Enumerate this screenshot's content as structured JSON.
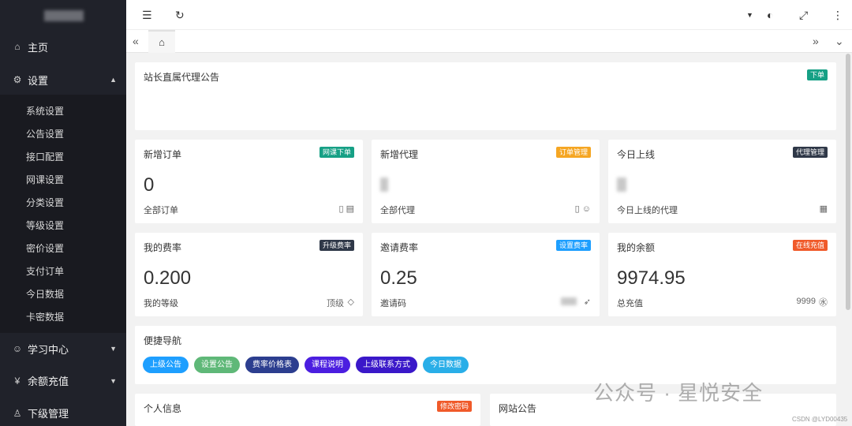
{
  "sidebar": {
    "items": [
      {
        "label": "主页",
        "icon": "home-icon"
      },
      {
        "label": "设置",
        "icon": "gear-icon"
      },
      {
        "label": "学习中心",
        "icon": "user-icon"
      },
      {
        "label": "余额充值",
        "icon": "yen-icon"
      },
      {
        "label": "下级管理",
        "icon": "users-icon"
      }
    ],
    "settings_sub": [
      "系统设置",
      "公告设置",
      "接口配置",
      "网课设置",
      "分类设置",
      "等级设置",
      "密价设置",
      "支付订单",
      "今日数据",
      "卡密数据"
    ]
  },
  "notice": {
    "title": "站长直属代理公告",
    "badge": "下单"
  },
  "stats": [
    {
      "title": "新增订单",
      "badge": "网课下单",
      "value": "0",
      "caption": "全部订单"
    },
    {
      "title": "新增代理",
      "badge": "订单管理",
      "value": "",
      "caption": "全部代理"
    },
    {
      "title": "今日上线",
      "badge": "代理管理",
      "value": "",
      "caption": "今日上线的代理"
    },
    {
      "title": "我的费率",
      "badge": "升级费率",
      "value": "0.200",
      "caption": "我的等级",
      "meta": "顶级"
    },
    {
      "title": "邀请费率",
      "badge": "设置费率",
      "value": "0.25",
      "caption": "邀请码"
    },
    {
      "title": "我的余额",
      "badge": "在线充值",
      "value": "9974.95",
      "caption": "总充值",
      "meta": "9999"
    }
  ],
  "quicknav": {
    "title": "便捷导航",
    "buttons": [
      "上级公告",
      "设置公告",
      "费率价格表",
      "课程说明",
      "上级联系方式",
      "今日数据"
    ]
  },
  "personal": {
    "title": "个人信息",
    "badge": "修改密码"
  },
  "site_notice": {
    "title": "网站公告"
  },
  "watermark": {
    "text": "公众号 · 星悦安全",
    "small": "CSDN @LYD00435"
  },
  "colors": {
    "sidebar_bg": "#20222a",
    "teal": "#16a085",
    "orange": "#f5a623",
    "navy": "#2f3848",
    "blue": "#1e9fff",
    "red": "#f05a2a"
  }
}
